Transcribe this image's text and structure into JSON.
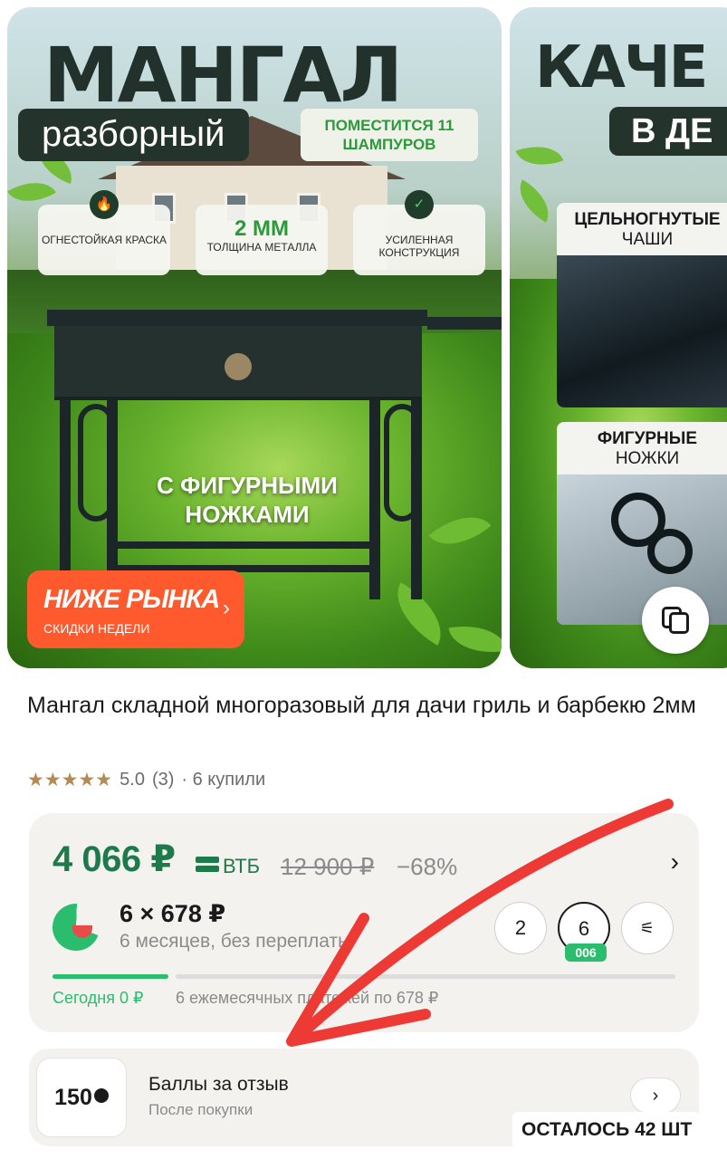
{
  "gallery": {
    "slide1": {
      "title": "МАНГАЛ",
      "subtitle": "разборный",
      "fits": "ПОМЕСТИТСЯ 11 ШАМПУРОВ",
      "features": [
        {
          "text": "ОГНЕСТОЙКАЯ КРАСКА",
          "icon": "flame-icon"
        },
        {
          "big": "2 ММ",
          "text": "ТОЛЩИНА МЕТАЛЛА"
        },
        {
          "text": "УСИЛЕННАЯ КОНСТРУКЦИЯ",
          "icon": "shield-check-icon"
        }
      ],
      "legs_label": "С ФИГУРНЫМИ НОЖКАМИ",
      "promo_title": "НИЖЕ РЫНКА",
      "promo_sub": "СКИДКИ НЕДЕЛИ"
    },
    "slide2": {
      "title": "КАЧЕ",
      "pill": "В ДЕ",
      "panel1_bold": "ЦЕЛЬНОГНУТЫЕ",
      "panel1_text": "ЧАШИ",
      "panel2_bold": "ФИГУРНЫЕ",
      "panel2_text": "НОЖКИ"
    }
  },
  "product": {
    "title": "Мангал складной многоразовый для дачи гриль и барбекю 2мм",
    "rating_value": "5.0",
    "rating_count": "(3)",
    "purchases": "· 6 купили"
  },
  "price": {
    "current": "4 066 ₽",
    "bank": "ВТБ",
    "old": "12 900 ₽",
    "discount": "−68%"
  },
  "installment": {
    "main": "6 × 678 ₽",
    "sub": "6 месяцев, без переплаты",
    "terms": [
      "2",
      "6"
    ],
    "badge": "006",
    "today": "Сегодня 0 ₽",
    "rest": "6 ежемесячных платежей по 678 ₽"
  },
  "review": {
    "points": "150",
    "title": "Баллы за отзыв",
    "sub": "После покупки"
  },
  "stock_label": "ОСТАЛОСЬ 42 ШТ",
  "colors": {
    "price_green": "#1f7a4b",
    "split_green": "#2bbd6e",
    "promo_orange": "#ff5a2e",
    "arrow_red": "#ee3a35",
    "stars": "#b48a52"
  }
}
